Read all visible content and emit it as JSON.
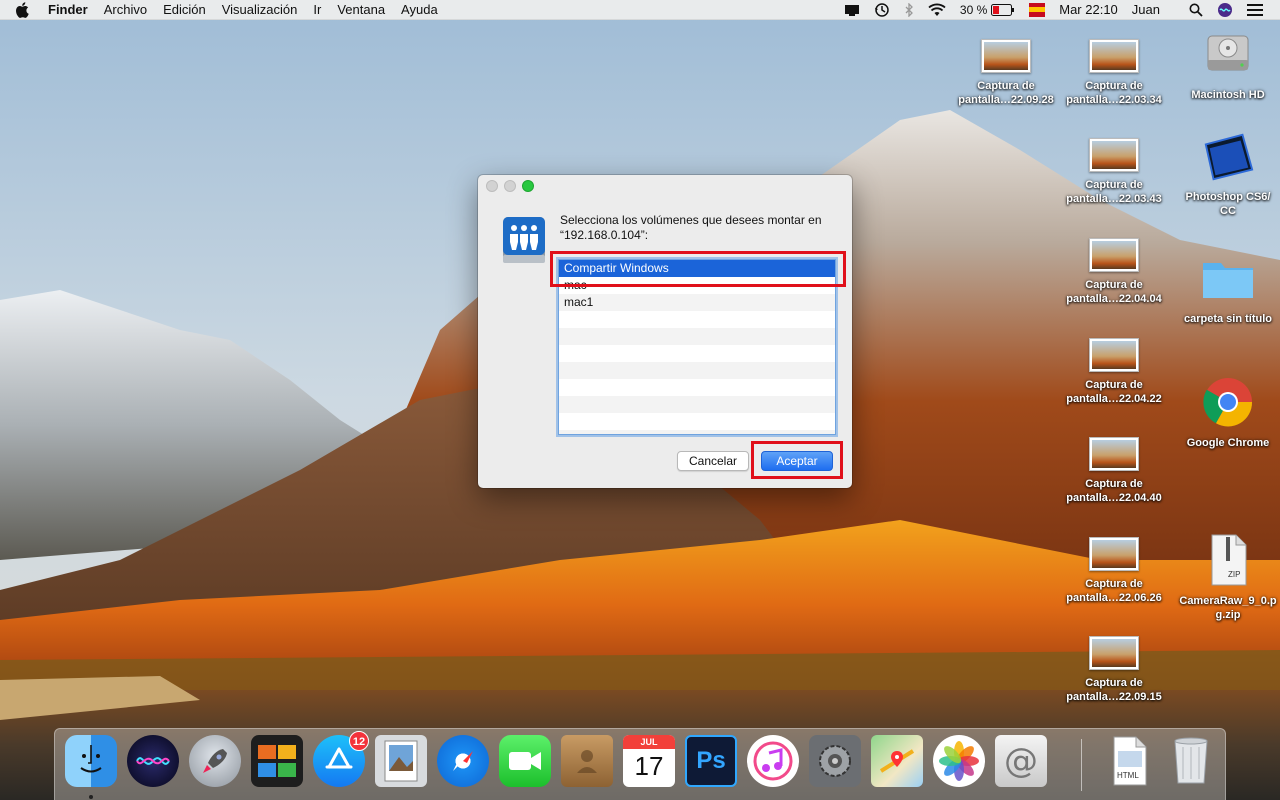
{
  "menubar": {
    "app_name": "Finder",
    "menus": [
      "Archivo",
      "Edición",
      "Visualización",
      "Ir",
      "Ventana",
      "Ayuda"
    ],
    "battery": "30 %",
    "clock": "Mar 22:10",
    "user": "Juan",
    "status_icons": [
      "display-icon",
      "time-machine-icon",
      "bluetooth-icon",
      "wifi-icon",
      "battery-icon",
      "flag-icon"
    ]
  },
  "dialog": {
    "prompt_line1": "Selecciona los volúmenes que desees montar en",
    "prompt_line2": "“192.168.0.104”:",
    "volumes": [
      {
        "name": "Compartir Windows",
        "selected": true
      },
      {
        "name": "mac",
        "selected": false
      },
      {
        "name": "mac1",
        "selected": false
      }
    ],
    "cancel_label": "Cancelar",
    "accept_label": "Aceptar",
    "highlight_color": "#e0101a"
  },
  "desktop_icons": {
    "col1": [
      {
        "line1": "Captura de",
        "line2": "pantalla…22.09.28"
      }
    ],
    "col2": [
      {
        "line1": "Captura de",
        "line2": "pantalla…22.03.34"
      },
      {
        "line1": "Captura de",
        "line2": "pantalla…22.03.43"
      },
      {
        "line1": "Captura de",
        "line2": "pantalla…22.04.04"
      },
      {
        "line1": "Captura de",
        "line2": "pantalla…22.04.22"
      },
      {
        "line1": "Captura de",
        "line2": "pantalla…22.04.40"
      },
      {
        "line1": "Captura de",
        "line2": "pantalla…22.06.26"
      },
      {
        "line1": "Captura de",
        "line2": "pantalla…22.09.15"
      }
    ],
    "col3": [
      {
        "line1": "Macintosh HD",
        "line2": ""
      },
      {
        "line1": "Photoshop CS6/",
        "line2": "CC"
      },
      {
        "line1": "carpeta sin título",
        "line2": ""
      },
      {
        "line1": "Google Chrome",
        "line2": ""
      },
      {
        "line1": "CameraRaw_9_0.p",
        "line2": "g.zip"
      }
    ],
    "zip_label": "ZIP"
  },
  "dock": {
    "apps": [
      "finder",
      "siri",
      "launchpad",
      "mission-control",
      "app-store",
      "preview",
      "safari",
      "facetime",
      "contacts",
      "calendar",
      "photoshop",
      "itunes",
      "system-preferences",
      "maps",
      "photos",
      "mail"
    ],
    "app_store_badge": "12",
    "calendar_month": "JUL",
    "calendar_day": "17",
    "photoshop_label": "Ps",
    "html_doc_label": "HTML"
  }
}
